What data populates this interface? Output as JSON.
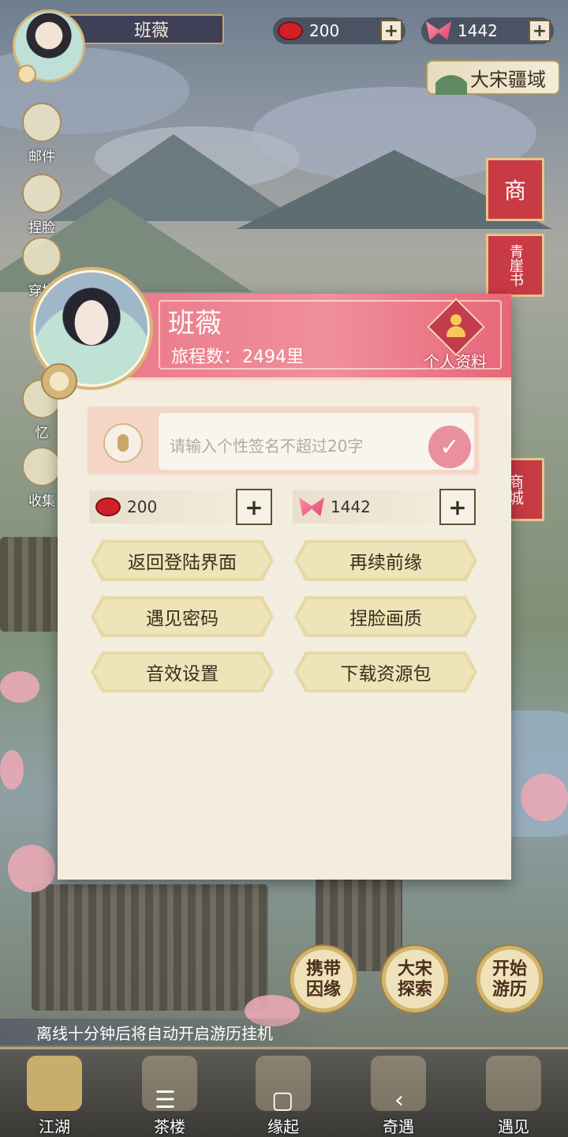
{
  "top": {
    "player_name": "班薇",
    "beans": "200",
    "butterflies": "1442",
    "plus_label": "+",
    "realm_label": "大宋疆域"
  },
  "side_menu": [
    {
      "label": "邮件",
      "icon": "mail-icon"
    },
    {
      "label": "捏脸",
      "icon": "face-edit-icon"
    },
    {
      "label": "穿搭",
      "icon": "outfit-icon"
    },
    {
      "label": "忆",
      "icon": "memory-icon"
    },
    {
      "label": "收集",
      "icon": "collection-icon"
    }
  ],
  "right_icons": [
    {
      "label": "商",
      "icon": "shop-icon"
    },
    {
      "label": "青崖书",
      "icon": "book-icon"
    },
    {
      "label": "商城",
      "icon": "mall-icon"
    }
  ],
  "panel": {
    "name": "班薇",
    "journey_label": "旅程数：",
    "journey_value": "2494里",
    "profile_button": "个人资料",
    "signature_placeholder": "请输入个性签名不超过20字",
    "confirm_symbol": "✓",
    "beans": "200",
    "butterflies": "1442",
    "plus_label": "+",
    "buttons": [
      "返回登陆界面",
      "再续前缘",
      "遇见密码",
      "捏脸画质",
      "音效设置",
      "下载资源包"
    ]
  },
  "actions": [
    {
      "line1": "携带",
      "line2": "因缘"
    },
    {
      "line1": "大宋",
      "line2": "探索"
    },
    {
      "line1": "开始",
      "line2": "游历"
    }
  ],
  "idle_tip": "离线十分钟后将自动开启游历挂机",
  "bottom_nav": [
    {
      "label": "江湖",
      "icon": "map-scroll-icon",
      "active": true
    },
    {
      "label": "茶楼",
      "icon": "teahouse-icon",
      "active": false
    },
    {
      "label": "缘起",
      "icon": "book-stack-icon",
      "active": false
    },
    {
      "label": "奇遇",
      "icon": "maple-leaf-icon",
      "active": false
    },
    {
      "label": "遇见",
      "icon": "lantern-icon",
      "active": false
    }
  ],
  "system_keys": {
    "menu": "☰",
    "home": "▢",
    "back": "‹"
  }
}
